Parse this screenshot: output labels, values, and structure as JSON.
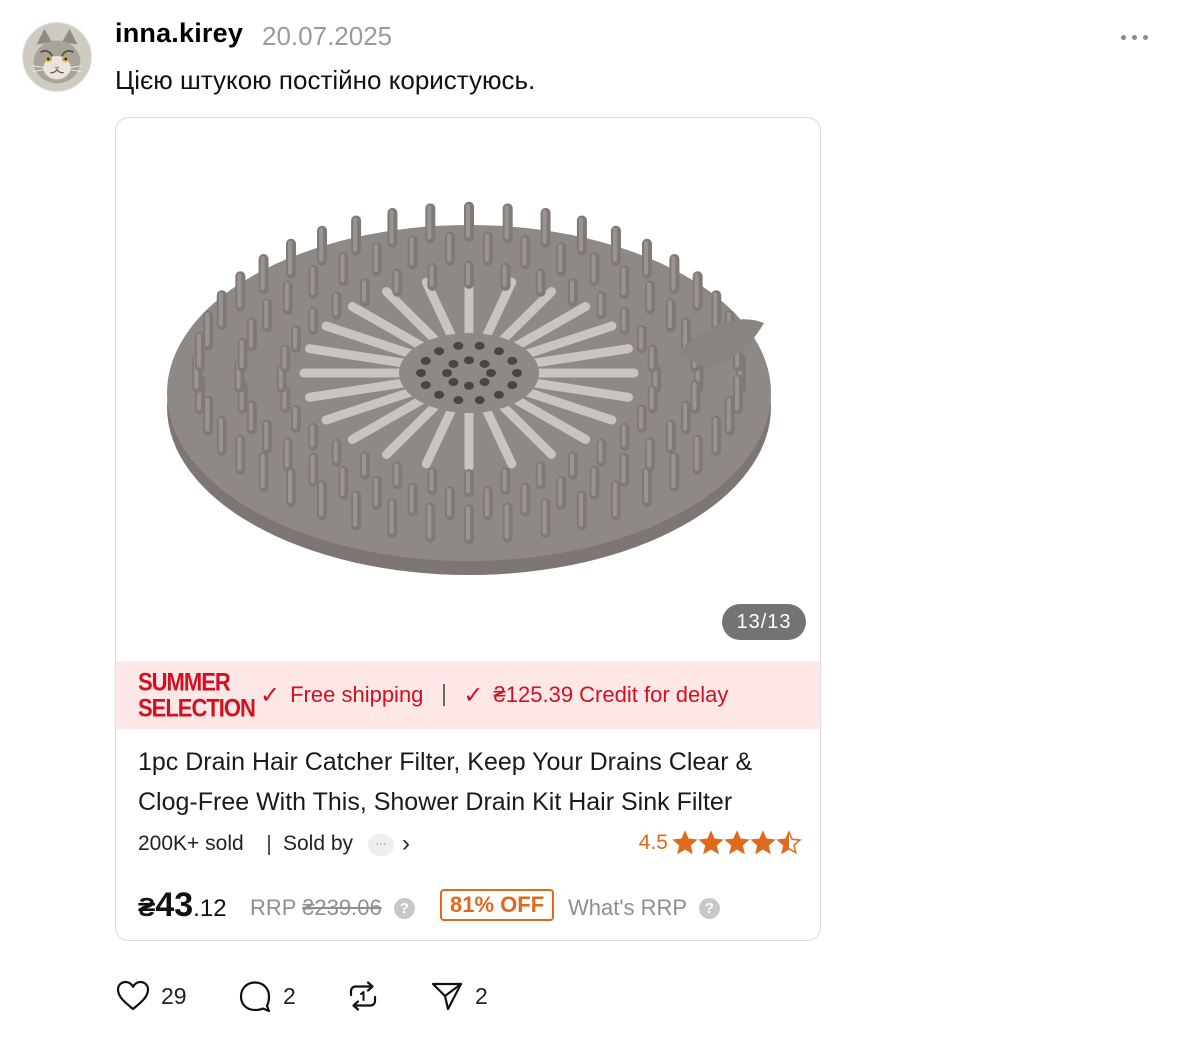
{
  "post": {
    "username": "inna.kirey",
    "date": "20.07.2025",
    "text": "Цією штукою постійно користуюсь."
  },
  "product": {
    "image_counter": "13/13",
    "promo": {
      "badge_line1": "SUMMER",
      "badge_line2": "SELECTION",
      "shipping": "Free shipping",
      "credit": "₴125.39 Credit for delay",
      "color": "#d41020"
    },
    "title": "1pc Drain Hair Catcher Filter, Keep Your Drains Clear & Clog-Free With This, Shower Drain Kit Hair Sink Filter",
    "sold": "200K+ sold",
    "sold_by": "Sold by",
    "rating": "4.5",
    "rating_value": 4.5,
    "price_currency": "₴",
    "price_int": "43",
    "price_dec": ".12",
    "rrp_label": "RRP",
    "rrp_old": "₴239.06",
    "discount": "81% OFF",
    "whats_rrp": "What's RRP",
    "accent_color": "#e0691c"
  },
  "actions": {
    "likes": "29",
    "replies": "2",
    "shares": "2"
  },
  "icons": [
    "more-icon",
    "check-icon",
    "chevron-right-icon",
    "star-icon",
    "help-icon",
    "heart-icon",
    "comment-icon",
    "repost-icon",
    "send-icon"
  ]
}
